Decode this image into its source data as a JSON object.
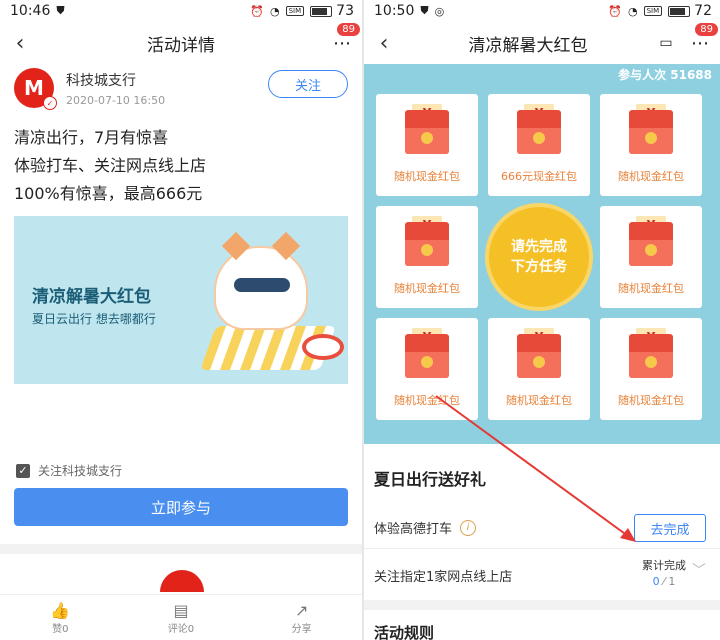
{
  "left": {
    "status": {
      "time": "10:46",
      "battery": "73",
      "sim": "SIM"
    },
    "header": {
      "title": "活动详情",
      "badge": "89"
    },
    "author": {
      "name": "科技城支行",
      "time": "2020-07-10 16:50",
      "follow": "关注"
    },
    "post_lines": [
      "清凉出行，7月有惊喜",
      "体验打车、关注网点线上店",
      "100%有惊喜，最高666元"
    ],
    "banner": {
      "title": "清凉解暑大红包",
      "subtitle": "夏日云出行 想去哪都行"
    },
    "agree_label": "关注科技城支行",
    "join_button": "立即参与",
    "bottom_bar": [
      {
        "icon": "thumb-up-icon",
        "label": "赞0"
      },
      {
        "icon": "comment-icon",
        "label": "评论0"
      },
      {
        "icon": "share-icon",
        "label": "分享"
      }
    ]
  },
  "right": {
    "status": {
      "time": "10:50",
      "battery": "72",
      "sim": "SIM"
    },
    "header": {
      "title": "清凉解暑大红包",
      "badge": "89"
    },
    "participants": "参与人次 51688",
    "cards": [
      "随机现金红包",
      "666元现金红包",
      "随机现金红包",
      "随机现金红包",
      "随机现金红包",
      "随机现金红包",
      "随机现金红包",
      "随机现金红包"
    ],
    "center_button": [
      "请先完成",
      "下方任务"
    ],
    "section_title": "夏日出行送好礼",
    "task1": {
      "label": "体验高德打车",
      "button": "去完成"
    },
    "task2": {
      "label": "关注指定1家网点线上店",
      "progress_label": "累计完成",
      "current": "0",
      "total": "1"
    },
    "rules_title": "活动规则"
  },
  "colors": {
    "accent_blue": "#3d87f5",
    "panel": "#8ecfe0",
    "annotation_arrow": "#e53935"
  }
}
